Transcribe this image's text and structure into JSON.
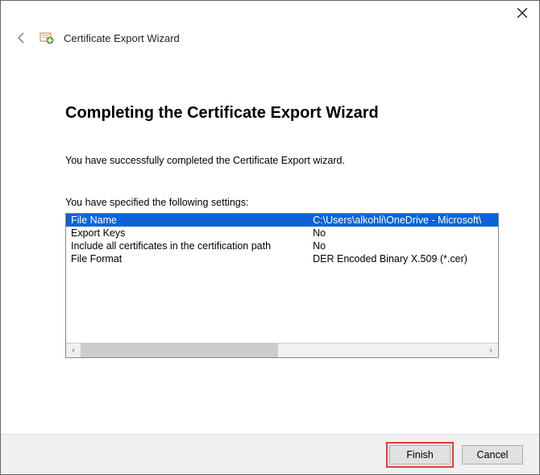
{
  "titlebar": {
    "close_tooltip": "Close"
  },
  "header": {
    "wizard_title": "Certificate Export Wizard"
  },
  "page": {
    "heading": "Completing the Certificate Export Wizard",
    "success_text": "You have successfully completed the Certificate Export wizard.",
    "settings_label": "You have specified the following settings:",
    "rows": [
      {
        "label": "File Name",
        "value": "C:\\Users\\alkohli\\OneDrive - Microsoft\\"
      },
      {
        "label": "Export Keys",
        "value": "No"
      },
      {
        "label": "Include all certificates in the certification path",
        "value": "No"
      },
      {
        "label": "File Format",
        "value": "DER Encoded Binary X.509 (*.cer)"
      }
    ]
  },
  "buttons": {
    "finish": "Finish",
    "cancel": "Cancel"
  },
  "scroll": {
    "left_glyph": "‹",
    "right_glyph": "›"
  }
}
